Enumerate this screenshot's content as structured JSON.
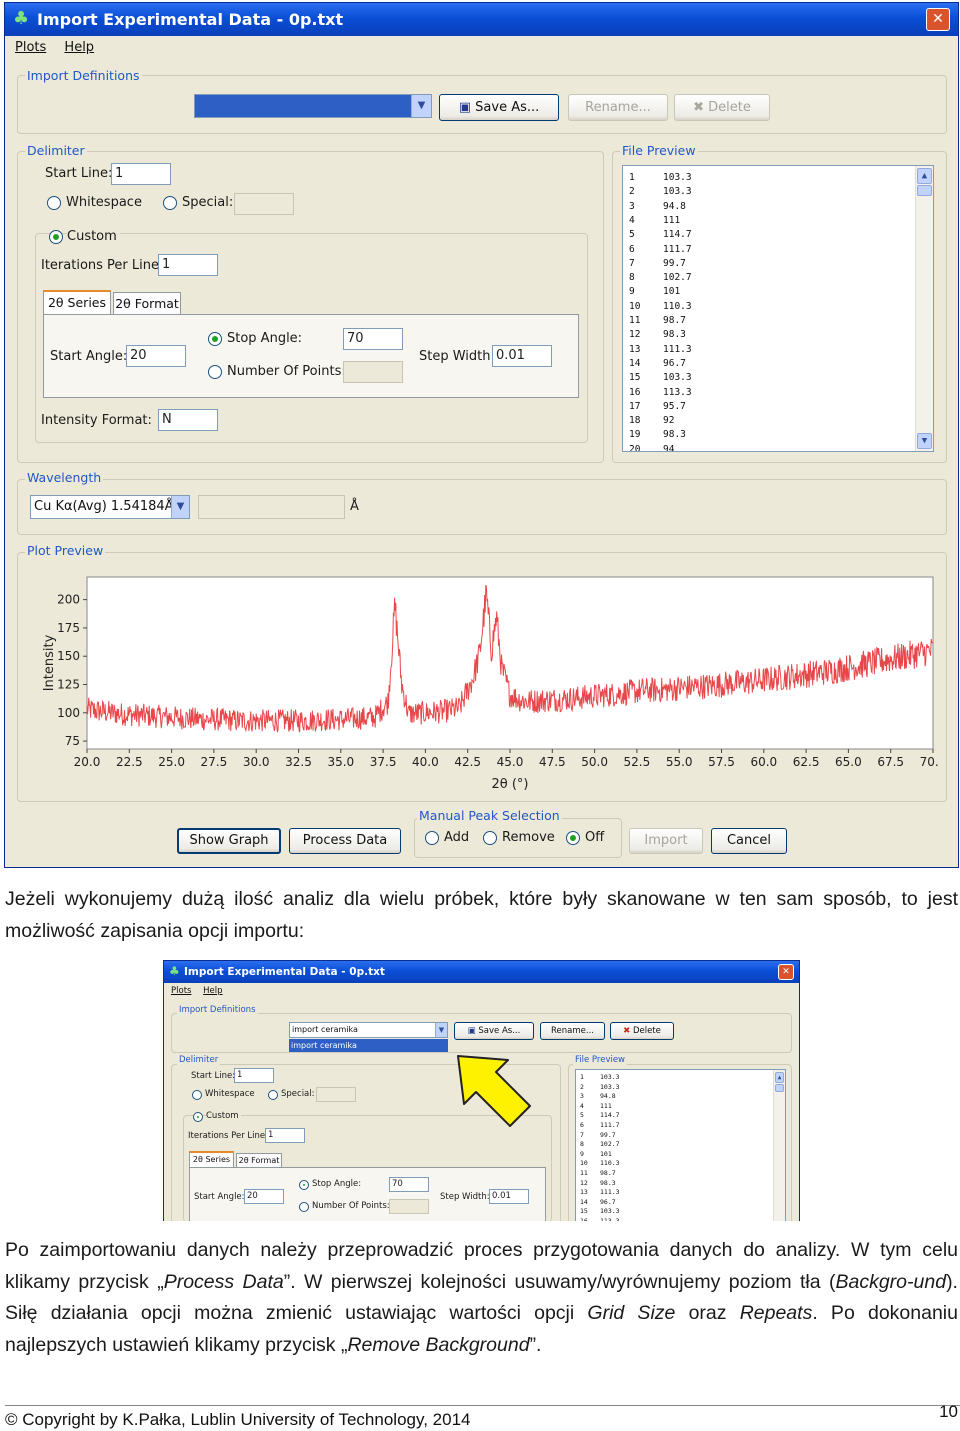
{
  "window": {
    "title": "Import Experimental Data - 0p.txt",
    "close": "✕",
    "menu": [
      "Plots",
      "Help"
    ]
  },
  "import_defs": {
    "legend": "Import Definitions",
    "combo_value": "",
    "save_as": "Save As...",
    "rename": "Rename...",
    "delete": "Delete"
  },
  "delimiter": {
    "legend": "Delimiter",
    "start_line_label": "Start Line:",
    "start_line_value": "1",
    "whitespace": "Whitespace",
    "special": "Special:",
    "custom": "Custom",
    "iterations_label": "Iterations Per Line:",
    "iterations_value": "1",
    "tab_series": "2θ Series",
    "tab_format": "2θ Format",
    "start_angle_label": "Start Angle:",
    "start_angle_value": "20",
    "stop_angle_label": "Stop Angle:",
    "stop_angle_value": "70",
    "num_points_label": "Number Of Points:",
    "step_width_label": "Step Width:",
    "step_width_value": "0.01",
    "intensity_label": "Intensity Format:",
    "intensity_value": "N"
  },
  "file_preview": {
    "legend": "File Preview",
    "rows": [
      [
        "1",
        "103.3"
      ],
      [
        "2",
        "103.3"
      ],
      [
        "3",
        "94.8"
      ],
      [
        "4",
        "111"
      ],
      [
        "5",
        "114.7"
      ],
      [
        "6",
        "111.7"
      ],
      [
        "7",
        "99.7"
      ],
      [
        "8",
        "102.7"
      ],
      [
        "9",
        "101"
      ],
      [
        "10",
        "110.3"
      ],
      [
        "11",
        "98.7"
      ],
      [
        "12",
        "98.3"
      ],
      [
        "13",
        "111.3"
      ],
      [
        "14",
        "96.7"
      ],
      [
        "15",
        "103.3"
      ],
      [
        "16",
        "113.3"
      ],
      [
        "17",
        "95.7"
      ],
      [
        "18",
        "92"
      ],
      [
        "19",
        "98.3"
      ],
      [
        "20",
        "94"
      ]
    ]
  },
  "wavelength": {
    "legend": "Wavelength",
    "combo_value": "Cu Kα(Avg) 1.54184Å",
    "unit": "Å"
  },
  "plot_preview": {
    "legend": "Plot Preview"
  },
  "chart_data": {
    "type": "line",
    "title": "",
    "xlabel": "2θ (°)",
    "ylabel": "Intensity",
    "xlim": [
      20.0,
      70.0
    ],
    "ylim": [
      68,
      220
    ],
    "xticks": [
      "20.0",
      "22.5",
      "25.0",
      "27.5",
      "30.0",
      "32.5",
      "35.0",
      "37.5",
      "40.0",
      "42.5",
      "45.0",
      "47.5",
      "50.0",
      "52.5",
      "55.0",
      "57.5",
      "60.0",
      "62.5",
      "65.0",
      "67.5",
      "70.0"
    ],
    "yticks": [
      "75",
      "100",
      "125",
      "150",
      "175",
      "200"
    ],
    "grid": false,
    "color": "#e8474a",
    "series": [
      {
        "x": [
          20.0,
          21.0,
          22.0,
          23.0,
          24.0,
          25.0,
          26.0,
          27.0,
          28.0,
          29.0,
          30.0,
          31.0,
          32.0,
          33.0,
          34.0,
          35.0,
          36.0,
          37.0,
          37.8,
          38.2,
          38.6,
          39.0,
          40.0,
          41.0,
          42.0,
          42.8,
          43.2,
          43.6,
          43.9,
          44.2,
          44.5,
          45.0,
          45.5,
          46.0,
          47.0,
          48.0,
          49.0,
          50.0,
          51.0,
          52.0,
          53.0,
          54.0,
          55.0,
          56.0,
          57.0,
          58.0,
          59.0,
          60.0,
          61.0,
          62.0,
          63.0,
          64.0,
          65.0,
          66.0,
          67.0,
          68.0,
          69.0,
          70.0
        ],
        "values": [
          103,
          101,
          99,
          98,
          97,
          96,
          95,
          94,
          94,
          93,
          93,
          93,
          93,
          93,
          94,
          94,
          95,
          96,
          110,
          195,
          125,
          99,
          100,
          101,
          104,
          130,
          152,
          205,
          155,
          185,
          140,
          116,
          112,
          110,
          111,
          112,
          113,
          115,
          116,
          118,
          120,
          120,
          122,
          123,
          124,
          126,
          127,
          129,
          131,
          133,
          135,
          137,
          140,
          143,
          146,
          149,
          152,
          155
        ]
      }
    ]
  },
  "bottom": {
    "show_graph": "Show Graph",
    "process_data": "Process Data",
    "manual_legend": "Manual Peak Selection",
    "add": "Add",
    "remove": "Remove",
    "off": "Off",
    "import": "Import",
    "cancel": "Cancel"
  },
  "paragraph1": "Jeżeli wykonujemy dużą ilość analiz dla wielu próbek, które były skanowane w ten sam sposób, to jest możliwość zapisania opcji importu:",
  "small": {
    "title": "Import Experimental Data - 0p.txt",
    "menu": [
      "Plots",
      "Help"
    ],
    "import_legend": "Import Definitions",
    "combo_value": "import ceramika",
    "combo_option": "import ceramika",
    "save_as": "Save As...",
    "rename": "Rename...",
    "delete": "Delete",
    "delimiter_legend": "Delimiter",
    "start_line_label": "Start Line:",
    "start_line_value": "1",
    "whitespace": "Whitespace",
    "special": "Special:",
    "custom": "Custom",
    "iterations_label": "Iterations Per Line:",
    "iterations_value": "1",
    "tab_series": "2θ Series",
    "tab_format": "2θ Format",
    "stop_angle_label": "Stop Angle:",
    "stop_angle_value": "70",
    "start_angle_label": "Start Angle:",
    "start_angle_value": "20",
    "step_width_label": "Step Width:",
    "step_width_value": "0.01",
    "num_points_label": "Number Of Points:",
    "preview_legend": "File Preview",
    "rows": [
      [
        "1",
        "103.3"
      ],
      [
        "2",
        "103.3"
      ],
      [
        "3",
        "94.8"
      ],
      [
        "4",
        "111"
      ],
      [
        "5",
        "114.7"
      ],
      [
        "6",
        "111.7"
      ],
      [
        "7",
        "99.7"
      ],
      [
        "8",
        "102.7"
      ],
      [
        "9",
        "101"
      ],
      [
        "10",
        "110.3"
      ],
      [
        "11",
        "98.7"
      ],
      [
        "12",
        "98.3"
      ],
      [
        "13",
        "111.3"
      ],
      [
        "14",
        "96.7"
      ],
      [
        "15",
        "103.3"
      ],
      [
        "16",
        "113.3"
      ]
    ]
  },
  "paragraph2": {
    "t1": "Po zaimportowaniu danych należy przeprowadzić proces przygotowania danych do analizy. W tym celu klikamy przycisk „",
    "e1": "Process Data",
    "t2": "”. W pierwszej kolejności usuwamy/wyrównujemy poziom tła (",
    "e2": "Backgro-und",
    "t3": "). Siłę działania opcji można zmienić ustawiając wartości opcji ",
    "e3": "Grid Size",
    "t4": " oraz ",
    "e4": "Repeats",
    "t5": ". Po dokonaniu najlepszych ustawień klikamy przycisk „",
    "e5": "Remove Background",
    "t6": "”."
  },
  "footer": {
    "copyright": "© Copyright by K.Pałka, Lublin University of Technology, 2014",
    "page": "10"
  }
}
